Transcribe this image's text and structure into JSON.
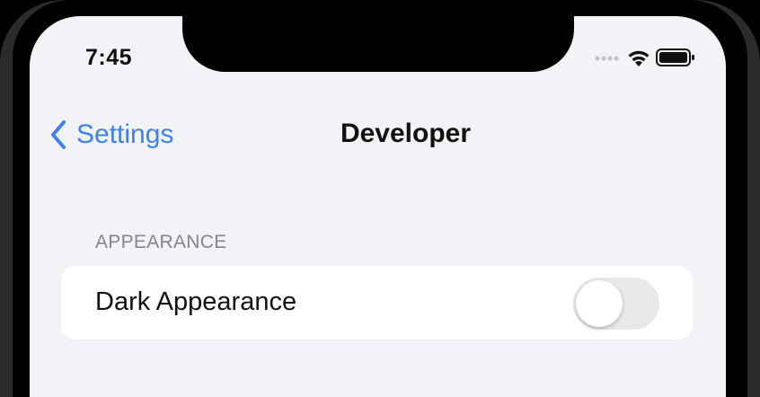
{
  "status_bar": {
    "time": "7:45",
    "signal_icon": "signal-dots-icon",
    "wifi_icon": "wifi-icon",
    "battery_icon": "battery-icon"
  },
  "nav": {
    "back_label": "Settings",
    "back_icon": "chevron-left-icon",
    "title": "Developer"
  },
  "sections": [
    {
      "header": "APPEARANCE",
      "rows": [
        {
          "label": "Dark Appearance",
          "toggle_on": false
        }
      ]
    }
  ],
  "colors": {
    "accent": "#3c82f0",
    "background": "#f2f2f7",
    "toggle_off": "#e9e9eb"
  }
}
